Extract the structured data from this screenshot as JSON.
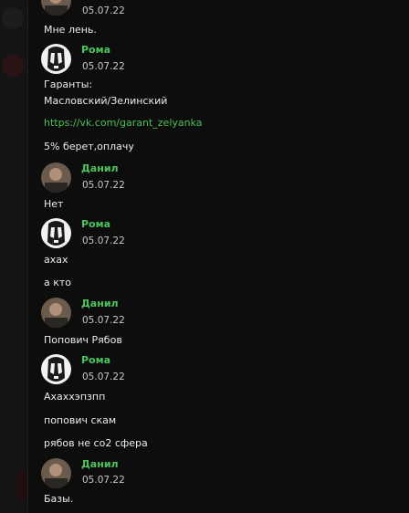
{
  "messages": [
    {
      "author": "",
      "date": "05.07.22",
      "avatar": "danil",
      "lines": [
        "Мне лень."
      ]
    },
    {
      "author": "Рома",
      "date": "05.07.22",
      "avatar": "roma",
      "lines": [
        "Гаранты:",
        "Масловский/Зелинский"
      ]
    },
    {
      "link": "https://vk.com/garant_zelyanka"
    },
    {
      "lines": [
        "5% берет,оплачу"
      ]
    },
    {
      "author": "Данил",
      "date": "05.07.22",
      "avatar": "danil",
      "lines": [
        "Нет"
      ]
    },
    {
      "author": "Рома",
      "date": "05.07.22",
      "avatar": "roma",
      "lines": [
        "ахах"
      ]
    },
    {
      "lines": [
        "а кто"
      ]
    },
    {
      "author": "Данил",
      "date": "05.07.22",
      "avatar": "danil",
      "lines": [
        "Попович Рябов"
      ]
    },
    {
      "author": "Рома",
      "date": "05.07.22",
      "avatar": "roma",
      "lines": [
        "Ахаххэпзпп"
      ]
    },
    {
      "lines": [
        "попович скам"
      ]
    },
    {
      "lines": [
        "рябов не со2 сфера"
      ]
    },
    {
      "author": "Данил",
      "date": "05.07.22",
      "avatar": "danil",
      "lines": [
        "Базы."
      ]
    }
  ],
  "colors": {
    "author": "#4cc45c",
    "link": "#4bbf55",
    "text": "#ececec",
    "date": "#c8c8c8",
    "background": "#0d0d0d"
  }
}
